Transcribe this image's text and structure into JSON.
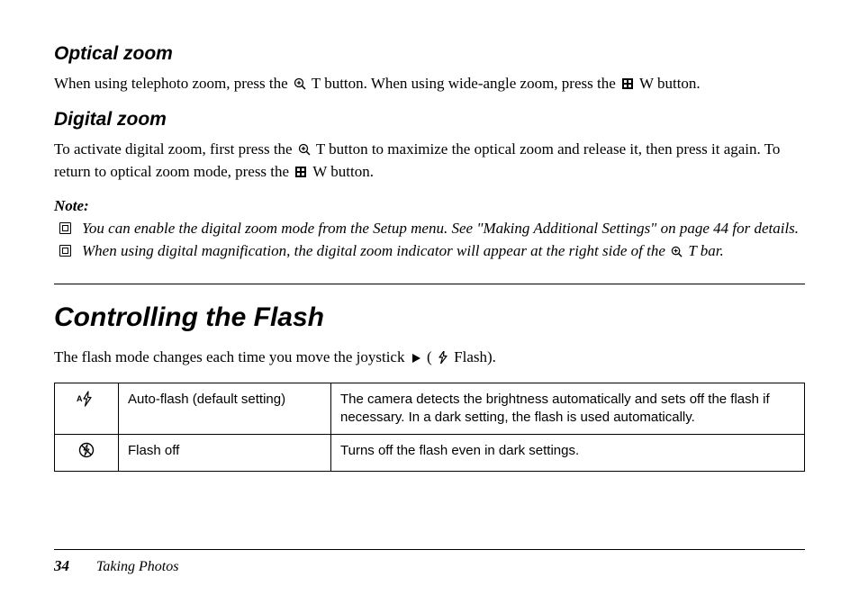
{
  "sections": {
    "optical": {
      "heading": "Optical zoom",
      "text_a": "When using telephoto zoom, press the ",
      "text_b": " T button. When using wide-angle zoom, press the ",
      "text_c": " W button."
    },
    "digital": {
      "heading": "Digital zoom",
      "text_a": "To activate digital zoom, first press the ",
      "text_b": " T button to maximize the optical zoom and release it, then press it again. To return to optical zoom mode, press the ",
      "text_c": " W button."
    },
    "note": {
      "label": "Note:",
      "item1": "You can enable the digital zoom mode from the Setup menu. See \"Making Additional Settings\" on page 44 for details.",
      "item2_a": "When using digital magnification, the digital zoom indicator will appear at the right side of the ",
      "item2_b": " T bar."
    },
    "flash": {
      "heading": "Controlling the Flash",
      "intro_a": "The flash mode changes each time you move the joystick ",
      "intro_b": " (",
      "intro_c": " Flash).",
      "rows": [
        {
          "mode": "Auto-flash (default setting)",
          "desc": "The camera detects the brightness automatically and sets off the flash if necessary. In a dark setting, the flash is used automatically."
        },
        {
          "mode": "Flash off",
          "desc": "Turns off the flash even in dark settings."
        }
      ]
    }
  },
  "footer": {
    "page_number": "34",
    "section_title": "Taking Photos"
  }
}
